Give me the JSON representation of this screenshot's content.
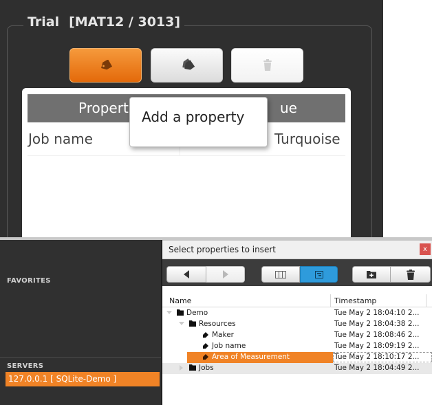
{
  "trial_panel": {
    "title": "Trial",
    "code": "[MAT12 / 3013]",
    "table": {
      "headers": [
        "Propert",
        "ue"
      ],
      "row": [
        "Job name",
        "Turquoise"
      ]
    },
    "popup": "Add a property"
  },
  "left_pane": {
    "favorites_title": "FAVORITES",
    "servers_title": "SERVERS",
    "server_item": "127.0.0.1 [ SQLite-Demo ]"
  },
  "dialog": {
    "title": "Select properties to insert",
    "close_label": "x",
    "columns": {
      "name": "Name",
      "timestamp": "Timestamp"
    },
    "rows": [
      {
        "name": "Demo",
        "timestamp": "Tue May 2 18:04:10 2..."
      },
      {
        "name": "Resources",
        "timestamp": "Tue May 2 18:04:38 2..."
      },
      {
        "name": "Maker",
        "timestamp": "Tue May 2 18:08:46 2..."
      },
      {
        "name": "Job name",
        "timestamp": "Tue May 2 18:09:19 2..."
      },
      {
        "name": "Area of Measurement",
        "timestamp": "Tue May 2 18:10:17 2..."
      },
      {
        "name": "Jobs",
        "timestamp": "Tue May 2 18:04:49 2..."
      }
    ]
  },
  "colors": {
    "accent_orange": "#f08326",
    "accent_blue": "#2e9bdc",
    "dark_bg": "#2f2f2f"
  },
  "icons": [
    "tag-icon",
    "tags-icon",
    "trash-icon",
    "back-icon",
    "forward-icon",
    "column-view-icon",
    "tree-view-icon",
    "new-folder-icon",
    "folder-icon"
  ]
}
